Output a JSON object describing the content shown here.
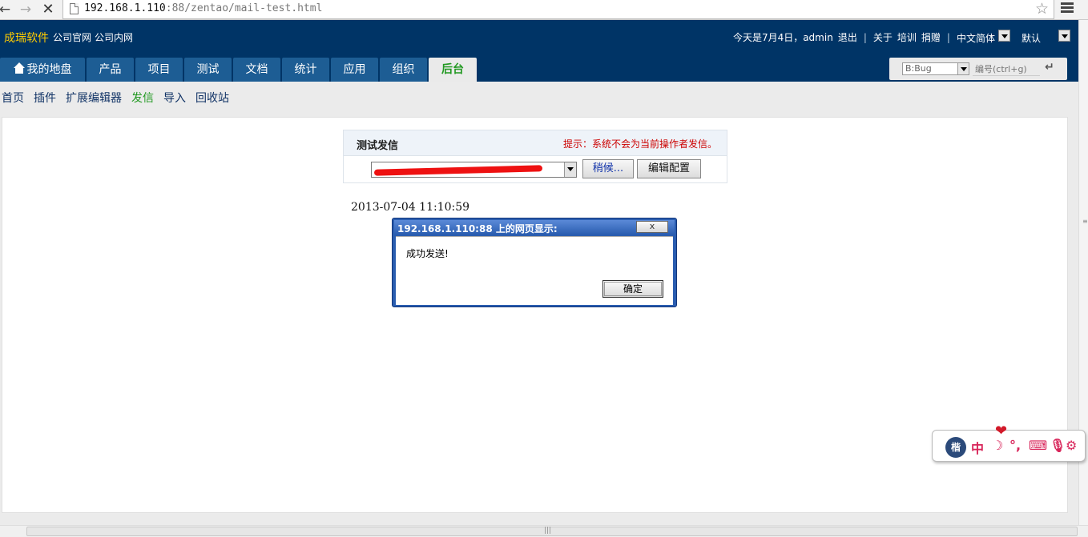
{
  "browser": {
    "url_host": "192.168.1.110",
    "url_rest": ":88/zentao/mail-test.html"
  },
  "header": {
    "brand": "成瑞软件",
    "links": [
      "公司官网",
      "公司内网"
    ],
    "greeting": "今天是7月4日，admin",
    "logout": "退出",
    "about": "关于",
    "training": "培训",
    "donate": "捐赠",
    "language": "中文简体",
    "theme": "默认"
  },
  "nav": {
    "tabs": [
      {
        "label": "我的地盘"
      },
      {
        "label": "产品"
      },
      {
        "label": "项目"
      },
      {
        "label": "测试"
      },
      {
        "label": "文档"
      },
      {
        "label": "统计"
      },
      {
        "label": "应用"
      },
      {
        "label": "组织"
      },
      {
        "label": "后台"
      }
    ]
  },
  "search": {
    "type": "B:Bug",
    "placeholder": "编号(ctrl+g)",
    "go_icon": "return-arrow-icon"
  },
  "subnav": {
    "items": [
      {
        "label": "首页"
      },
      {
        "label": "插件"
      },
      {
        "label": "扩展编辑器"
      },
      {
        "label": "发信"
      },
      {
        "label": "导入"
      },
      {
        "label": "回收站"
      }
    ]
  },
  "mail_panel": {
    "title": "测试发信",
    "hint": "提示：系统不会为当前操作者发信。",
    "later_button": "稍候...",
    "edit_button": "编辑配置"
  },
  "timestamp": "2013-07-04 11:10:59",
  "dialog": {
    "title": "192.168.1.110:88 上的网页显示:",
    "close": "x",
    "message": "成功发送!",
    "ok": "确定"
  },
  "ime": {
    "logo": "楷",
    "mode": "中",
    "width_icon": "moon-icon",
    "punct": "°,",
    "keyboard_icon": "keyboard-icon",
    "mic_icon": "mic-icon",
    "settings_icon": "gear-icon"
  }
}
